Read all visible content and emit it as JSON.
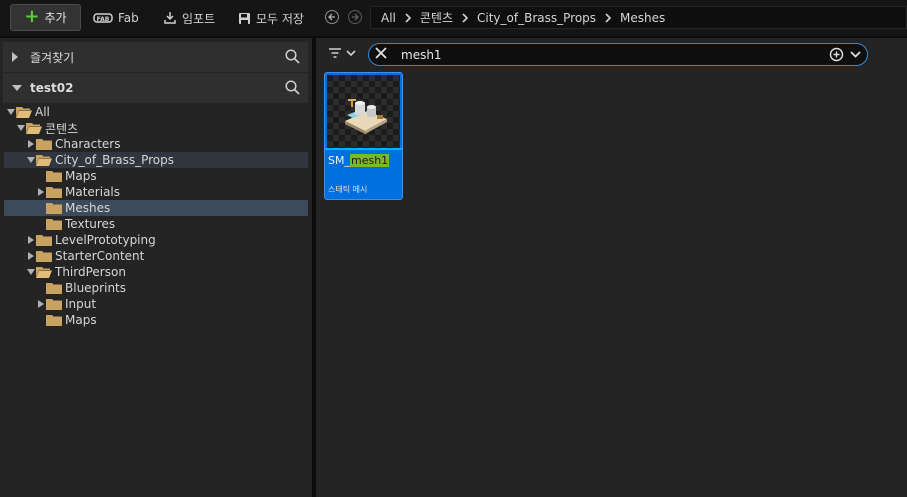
{
  "toolbar": {
    "add_label": "추가",
    "fab_label": "Fab",
    "import_label": "임포트",
    "save_all_label": "모두 저장"
  },
  "breadcrumb": [
    "All",
    "콘텐츠",
    "City_of_Brass_Props",
    "Meshes"
  ],
  "left_panel": {
    "favorites_label": "즐겨찾기",
    "project_label": "test02",
    "tree": [
      {
        "label": "All",
        "depth": 0,
        "arrow": "down",
        "folder": "open"
      },
      {
        "label": "콘텐츠",
        "depth": 1,
        "arrow": "down",
        "folder": "open"
      },
      {
        "label": "Characters",
        "depth": 2,
        "arrow": "right",
        "folder": "closed"
      },
      {
        "label": "City_of_Brass_Props",
        "depth": 2,
        "arrow": "down",
        "folder": "open",
        "state": "hl"
      },
      {
        "label": "Maps",
        "depth": 3,
        "arrow": "none",
        "folder": "closed"
      },
      {
        "label": "Materials",
        "depth": 3,
        "arrow": "right",
        "folder": "closed"
      },
      {
        "label": "Meshes",
        "depth": 3,
        "arrow": "none",
        "folder": "closed",
        "state": "sel"
      },
      {
        "label": "Textures",
        "depth": 3,
        "arrow": "none",
        "folder": "closed"
      },
      {
        "label": "LevelPrototyping",
        "depth": 2,
        "arrow": "right",
        "folder": "closed"
      },
      {
        "label": "StarterContent",
        "depth": 2,
        "arrow": "right",
        "folder": "closed"
      },
      {
        "label": "ThirdPerson",
        "depth": 2,
        "arrow": "down",
        "folder": "open"
      },
      {
        "label": "Blueprints",
        "depth": 3,
        "arrow": "none",
        "folder": "closed"
      },
      {
        "label": "Input",
        "depth": 3,
        "arrow": "right",
        "folder": "closed"
      },
      {
        "label": "Maps",
        "depth": 3,
        "arrow": "none",
        "folder": "closed"
      }
    ]
  },
  "search": {
    "value": "mesh1"
  },
  "assets": [
    {
      "name_prefix": "SM_",
      "name_match": "mesh1",
      "type": "스태틱 메시"
    }
  ],
  "colors": {
    "folder": "#c8a260",
    "accent_blue": "#0070e0",
    "match_highlight": "#7db72a",
    "add_icon": "#5bcc3b"
  }
}
